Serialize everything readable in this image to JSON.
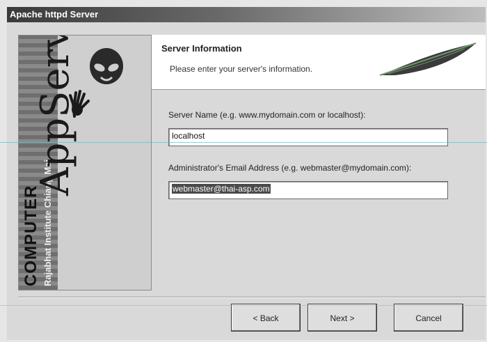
{
  "window": {
    "title": "Apache httpd Server"
  },
  "banner": {
    "vertical_text_main": "COMPUTER",
    "vertical_text_sub": "Rajabhat Institute Chiang Mai",
    "logo_text": "AppServ"
  },
  "header": {
    "title": "Server Information",
    "subtitle": "Please enter your server's information."
  },
  "form": {
    "server_name_label": "Server Name (e.g. www.mydomain.com or localhost):",
    "server_name_value": "localhost",
    "admin_email_label": "Administrator's Email Address (e.g. webmaster@mydomain.com):",
    "admin_email_value": "webmaster@thai-asp.com"
  },
  "buttons": {
    "back": "< Back",
    "next": "Next >",
    "cancel": "Cancel"
  },
  "icons": [
    "alien-icon",
    "hand-icon",
    "feather-icon"
  ]
}
